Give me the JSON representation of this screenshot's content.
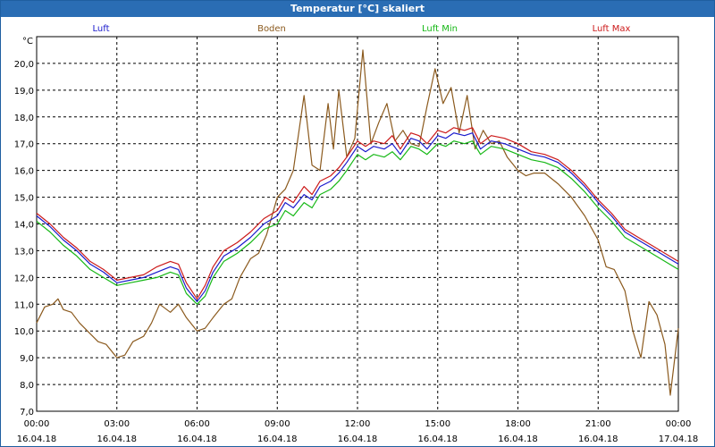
{
  "window": {
    "title": "Temperatur [°C] skaliert"
  },
  "chart_data": {
    "type": "line",
    "title": "Temperatur [°C] skaliert",
    "ylabel": "°C",
    "ylim": [
      7.0,
      21.0
    ],
    "yticks": [
      {
        "v": 7.0,
        "label": "7,0"
      },
      {
        "v": 8.0,
        "label": "8,0"
      },
      {
        "v": 9.0,
        "label": "9,0"
      },
      {
        "v": 10.0,
        "label": "10,0"
      },
      {
        "v": 11.0,
        "label": "11,0"
      },
      {
        "v": 12.0,
        "label": "12,0"
      },
      {
        "v": 13.0,
        "label": "13,0"
      },
      {
        "v": 14.0,
        "label": "14,0"
      },
      {
        "v": 15.0,
        "label": "15,0"
      },
      {
        "v": 16.0,
        "label": "16,0"
      },
      {
        "v": 17.0,
        "label": "17,0"
      },
      {
        "v": 18.0,
        "label": "18,0"
      },
      {
        "v": 19.0,
        "label": "19,0"
      },
      {
        "v": 20.0,
        "label": "20,0"
      }
    ],
    "xlim": [
      0,
      24
    ],
    "xticks": [
      {
        "v": 0,
        "time": "00:00",
        "date": "16.04.18"
      },
      {
        "v": 3,
        "time": "03:00",
        "date": "16.04.18"
      },
      {
        "v": 6,
        "time": "06:00",
        "date": "16.04.18"
      },
      {
        "v": 9,
        "time": "09:00",
        "date": "16.04.18"
      },
      {
        "v": 12,
        "time": "12:00",
        "date": "16.04.18"
      },
      {
        "v": 15,
        "time": "15:00",
        "date": "16.04.18"
      },
      {
        "v": 18,
        "time": "18:00",
        "date": "16.04.18"
      },
      {
        "v": 21,
        "time": "21:00",
        "date": "16.04.18"
      },
      {
        "v": 24,
        "time": "00:00",
        "date": "17.04.18"
      }
    ],
    "grid": true,
    "legend_position": "top",
    "series": [
      {
        "name": "Luft",
        "color": "#1a1acc",
        "points": [
          [
            0,
            14.3
          ],
          [
            0.5,
            13.9
          ],
          [
            1,
            13.4
          ],
          [
            1.5,
            13.0
          ],
          [
            2,
            12.5
          ],
          [
            2.5,
            12.2
          ],
          [
            3,
            11.8
          ],
          [
            3.5,
            11.9
          ],
          [
            4,
            12.0
          ],
          [
            4.5,
            12.2
          ],
          [
            5,
            12.4
          ],
          [
            5.3,
            12.3
          ],
          [
            5.6,
            11.6
          ],
          [
            6,
            11.1
          ],
          [
            6.3,
            11.5
          ],
          [
            6.6,
            12.2
          ],
          [
            7,
            12.8
          ],
          [
            7.5,
            13.1
          ],
          [
            8,
            13.5
          ],
          [
            8.5,
            14.0
          ],
          [
            9,
            14.3
          ],
          [
            9.3,
            14.8
          ],
          [
            9.6,
            14.6
          ],
          [
            10,
            15.1
          ],
          [
            10.3,
            14.9
          ],
          [
            10.6,
            15.4
          ],
          [
            11,
            15.6
          ],
          [
            11.3,
            15.9
          ],
          [
            11.6,
            16.3
          ],
          [
            12,
            16.9
          ],
          [
            12.3,
            16.7
          ],
          [
            12.6,
            16.9
          ],
          [
            13,
            16.8
          ],
          [
            13.3,
            17.0
          ],
          [
            13.6,
            16.6
          ],
          [
            14,
            17.2
          ],
          [
            14.3,
            17.1
          ],
          [
            14.6,
            16.8
          ],
          [
            15,
            17.3
          ],
          [
            15.3,
            17.2
          ],
          [
            15.6,
            17.4
          ],
          [
            16,
            17.3
          ],
          [
            16.3,
            17.4
          ],
          [
            16.6,
            16.8
          ],
          [
            17,
            17.1
          ],
          [
            17.5,
            17.0
          ],
          [
            18,
            16.8
          ],
          [
            18.5,
            16.6
          ],
          [
            19,
            16.5
          ],
          [
            19.5,
            16.3
          ],
          [
            20,
            15.9
          ],
          [
            20.5,
            15.4
          ],
          [
            21,
            14.8
          ],
          [
            21.5,
            14.3
          ],
          [
            22,
            13.7
          ],
          [
            22.5,
            13.4
          ],
          [
            23,
            13.1
          ],
          [
            23.5,
            12.8
          ],
          [
            24,
            12.5
          ]
        ]
      },
      {
        "name": "Boden",
        "color": "#8b5a1e",
        "points": [
          [
            0,
            10.3
          ],
          [
            0.3,
            10.9
          ],
          [
            0.6,
            11.0
          ],
          [
            0.8,
            11.2
          ],
          [
            1,
            10.8
          ],
          [
            1.3,
            10.7
          ],
          [
            1.6,
            10.3
          ],
          [
            2,
            9.9
          ],
          [
            2.3,
            9.6
          ],
          [
            2.6,
            9.5
          ],
          [
            3,
            9.0
          ],
          [
            3.3,
            9.1
          ],
          [
            3.6,
            9.6
          ],
          [
            4,
            9.8
          ],
          [
            4.3,
            10.3
          ],
          [
            4.6,
            11.0
          ],
          [
            5,
            10.7
          ],
          [
            5.3,
            11.0
          ],
          [
            5.6,
            10.5
          ],
          [
            6,
            10.0
          ],
          [
            6.3,
            10.1
          ],
          [
            6.6,
            10.5
          ],
          [
            7,
            11.0
          ],
          [
            7.3,
            11.2
          ],
          [
            7.6,
            12.0
          ],
          [
            8,
            12.7
          ],
          [
            8.3,
            12.9
          ],
          [
            8.6,
            13.6
          ],
          [
            9,
            15.0
          ],
          [
            9.3,
            15.3
          ],
          [
            9.6,
            16.0
          ],
          [
            10,
            18.8
          ],
          [
            10.3,
            16.2
          ],
          [
            10.6,
            16.0
          ],
          [
            10.9,
            18.5
          ],
          [
            11.1,
            16.8
          ],
          [
            11.3,
            19.0
          ],
          [
            11.6,
            16.5
          ],
          [
            11.9,
            17.2
          ],
          [
            12.2,
            20.5
          ],
          [
            12.5,
            17.0
          ],
          [
            12.8,
            17.8
          ],
          [
            13.1,
            18.5
          ],
          [
            13.4,
            17.1
          ],
          [
            13.7,
            17.5
          ],
          [
            14,
            17.0
          ],
          [
            14.3,
            16.9
          ],
          [
            14.6,
            18.4
          ],
          [
            14.9,
            19.8
          ],
          [
            15.2,
            18.5
          ],
          [
            15.5,
            19.1
          ],
          [
            15.8,
            17.4
          ],
          [
            16.1,
            18.8
          ],
          [
            16.4,
            16.8
          ],
          [
            16.7,
            17.5
          ],
          [
            17,
            17.0
          ],
          [
            17.3,
            17.1
          ],
          [
            17.6,
            16.5
          ],
          [
            18,
            16.0
          ],
          [
            18.3,
            15.8
          ],
          [
            18.6,
            15.9
          ],
          [
            19,
            15.9
          ],
          [
            19.5,
            15.5
          ],
          [
            20,
            15.0
          ],
          [
            20.5,
            14.3
          ],
          [
            21,
            13.4
          ],
          [
            21.3,
            12.4
          ],
          [
            21.6,
            12.3
          ],
          [
            22,
            11.5
          ],
          [
            22.3,
            10.0
          ],
          [
            22.6,
            9.0
          ],
          [
            22.9,
            11.1
          ],
          [
            23.2,
            10.6
          ],
          [
            23.5,
            9.5
          ],
          [
            23.7,
            7.6
          ],
          [
            24,
            10.1
          ]
        ]
      },
      {
        "name": "Luft Min",
        "color": "#16b816",
        "points": [
          [
            0,
            14.1
          ],
          [
            0.5,
            13.7
          ],
          [
            1,
            13.2
          ],
          [
            1.5,
            12.8
          ],
          [
            2,
            12.3
          ],
          [
            2.5,
            12.0
          ],
          [
            3,
            11.7
          ],
          [
            3.5,
            11.8
          ],
          [
            4,
            11.9
          ],
          [
            4.5,
            12.0
          ],
          [
            5,
            12.2
          ],
          [
            5.3,
            12.1
          ],
          [
            5.6,
            11.4
          ],
          [
            6,
            11.0
          ],
          [
            6.3,
            11.3
          ],
          [
            6.6,
            12.0
          ],
          [
            7,
            12.6
          ],
          [
            7.5,
            12.9
          ],
          [
            8,
            13.3
          ],
          [
            8.5,
            13.8
          ],
          [
            9,
            14.0
          ],
          [
            9.3,
            14.5
          ],
          [
            9.6,
            14.3
          ],
          [
            10,
            14.8
          ],
          [
            10.3,
            14.6
          ],
          [
            10.6,
            15.1
          ],
          [
            11,
            15.3
          ],
          [
            11.3,
            15.6
          ],
          [
            11.6,
            16.0
          ],
          [
            12,
            16.6
          ],
          [
            12.3,
            16.4
          ],
          [
            12.6,
            16.6
          ],
          [
            13,
            16.5
          ],
          [
            13.3,
            16.7
          ],
          [
            13.6,
            16.4
          ],
          [
            14,
            16.9
          ],
          [
            14.3,
            16.8
          ],
          [
            14.6,
            16.6
          ],
          [
            15,
            17.0
          ],
          [
            15.3,
            16.9
          ],
          [
            15.6,
            17.1
          ],
          [
            16,
            17.0
          ],
          [
            16.3,
            17.1
          ],
          [
            16.6,
            16.6
          ],
          [
            17,
            16.9
          ],
          [
            17.5,
            16.8
          ],
          [
            18,
            16.6
          ],
          [
            18.5,
            16.4
          ],
          [
            19,
            16.3
          ],
          [
            19.5,
            16.1
          ],
          [
            20,
            15.7
          ],
          [
            20.5,
            15.2
          ],
          [
            21,
            14.6
          ],
          [
            21.5,
            14.1
          ],
          [
            22,
            13.5
          ],
          [
            22.5,
            13.2
          ],
          [
            23,
            12.9
          ],
          [
            23.5,
            12.6
          ],
          [
            24,
            12.3
          ]
        ]
      },
      {
        "name": "Luft Max",
        "color": "#cc1a1a",
        "points": [
          [
            0,
            14.4
          ],
          [
            0.5,
            14.0
          ],
          [
            1,
            13.5
          ],
          [
            1.5,
            13.1
          ],
          [
            2,
            12.6
          ],
          [
            2.5,
            12.3
          ],
          [
            3,
            11.9
          ],
          [
            3.5,
            12.0
          ],
          [
            4,
            12.1
          ],
          [
            4.5,
            12.4
          ],
          [
            5,
            12.6
          ],
          [
            5.3,
            12.5
          ],
          [
            5.6,
            11.8
          ],
          [
            6,
            11.2
          ],
          [
            6.3,
            11.7
          ],
          [
            6.6,
            12.4
          ],
          [
            7,
            13.0
          ],
          [
            7.5,
            13.3
          ],
          [
            8,
            13.7
          ],
          [
            8.5,
            14.2
          ],
          [
            9,
            14.5
          ],
          [
            9.3,
            15.0
          ],
          [
            9.6,
            14.8
          ],
          [
            10,
            15.4
          ],
          [
            10.3,
            15.1
          ],
          [
            10.6,
            15.6
          ],
          [
            11,
            15.8
          ],
          [
            11.3,
            16.1
          ],
          [
            11.6,
            16.5
          ],
          [
            12,
            17.1
          ],
          [
            12.3,
            16.9
          ],
          [
            12.6,
            17.1
          ],
          [
            13,
            17.0
          ],
          [
            13.3,
            17.3
          ],
          [
            13.6,
            16.8
          ],
          [
            14,
            17.4
          ],
          [
            14.3,
            17.3
          ],
          [
            14.6,
            17.0
          ],
          [
            15,
            17.5
          ],
          [
            15.3,
            17.4
          ],
          [
            15.6,
            17.6
          ],
          [
            16,
            17.5
          ],
          [
            16.3,
            17.6
          ],
          [
            16.6,
            17.0
          ],
          [
            17,
            17.3
          ],
          [
            17.5,
            17.2
          ],
          [
            18,
            17.0
          ],
          [
            18.5,
            16.7
          ],
          [
            19,
            16.6
          ],
          [
            19.5,
            16.4
          ],
          [
            20,
            16.0
          ],
          [
            20.5,
            15.5
          ],
          [
            21,
            14.9
          ],
          [
            21.5,
            14.4
          ],
          [
            22,
            13.8
          ],
          [
            22.5,
            13.5
          ],
          [
            23,
            13.2
          ],
          [
            23.5,
            12.9
          ],
          [
            24,
            12.6
          ]
        ]
      }
    ]
  }
}
